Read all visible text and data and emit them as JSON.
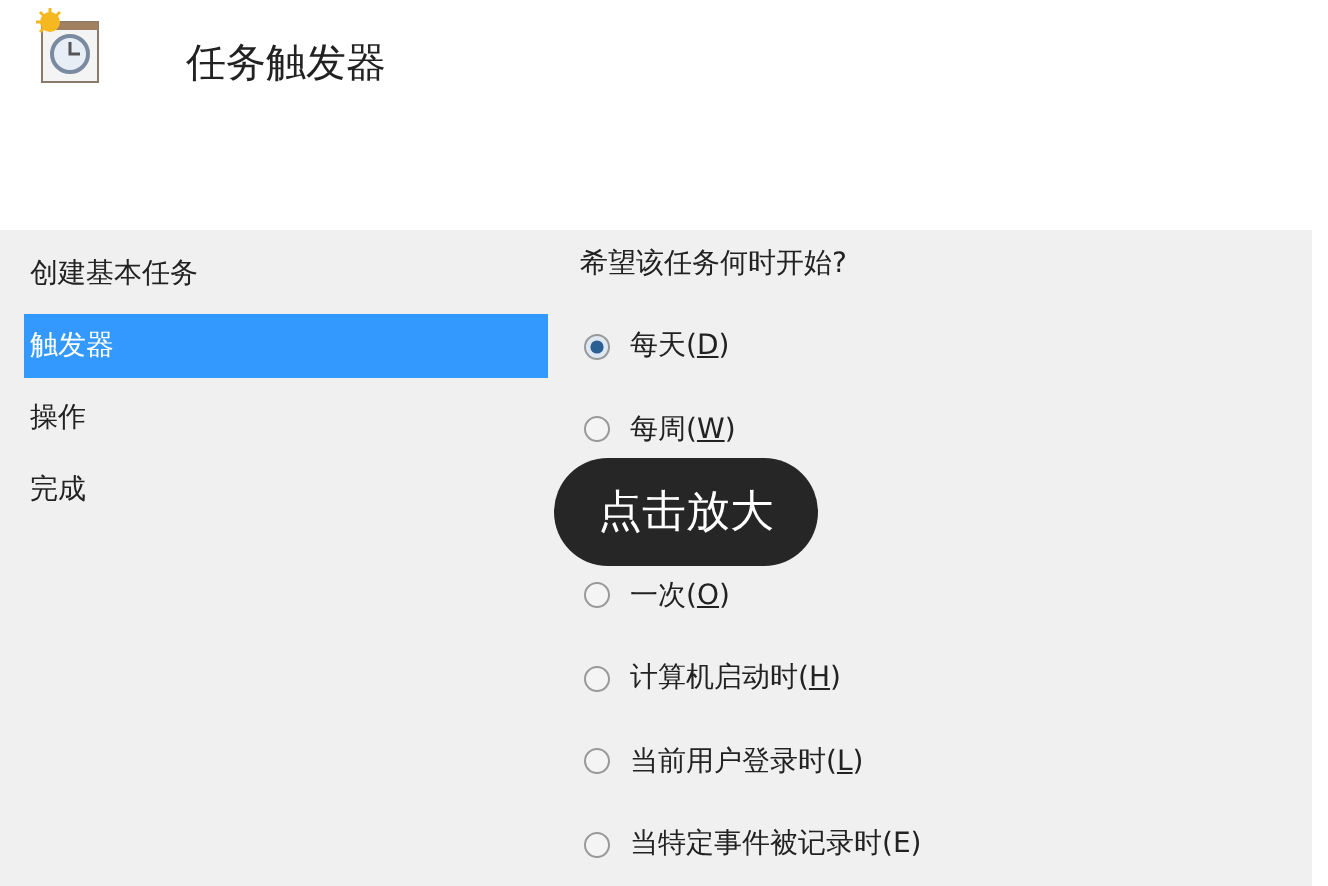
{
  "header": {
    "title": "任务触发器"
  },
  "sidebar": {
    "items": [
      {
        "label": "创建基本任务",
        "selected": false
      },
      {
        "label": "触发器",
        "selected": true
      },
      {
        "label": "操作",
        "selected": false
      },
      {
        "label": "完成",
        "selected": false
      }
    ]
  },
  "content": {
    "question": "希望该任务何时开始?",
    "rows": [
      {
        "kind": "radio",
        "before": "每天(",
        "key": "D",
        "after": ")",
        "selected": true
      },
      {
        "kind": "radio",
        "before": "每周(",
        "key": "W",
        "after": ")",
        "selected": false
      },
      {
        "kind": "overlay",
        "label": "点击放大"
      },
      {
        "kind": "radio",
        "before": "一次(",
        "key": "O",
        "after": ")",
        "selected": false
      },
      {
        "kind": "radio",
        "before": "计算机启动时(",
        "key": "H",
        "after": ")",
        "selected": false
      },
      {
        "kind": "radio",
        "before": "当前用户登录时(",
        "key": "L",
        "after": ")",
        "selected": false
      },
      {
        "kind": "radio",
        "before": "当特定事件被记录时(E)",
        "selected": false
      }
    ]
  }
}
